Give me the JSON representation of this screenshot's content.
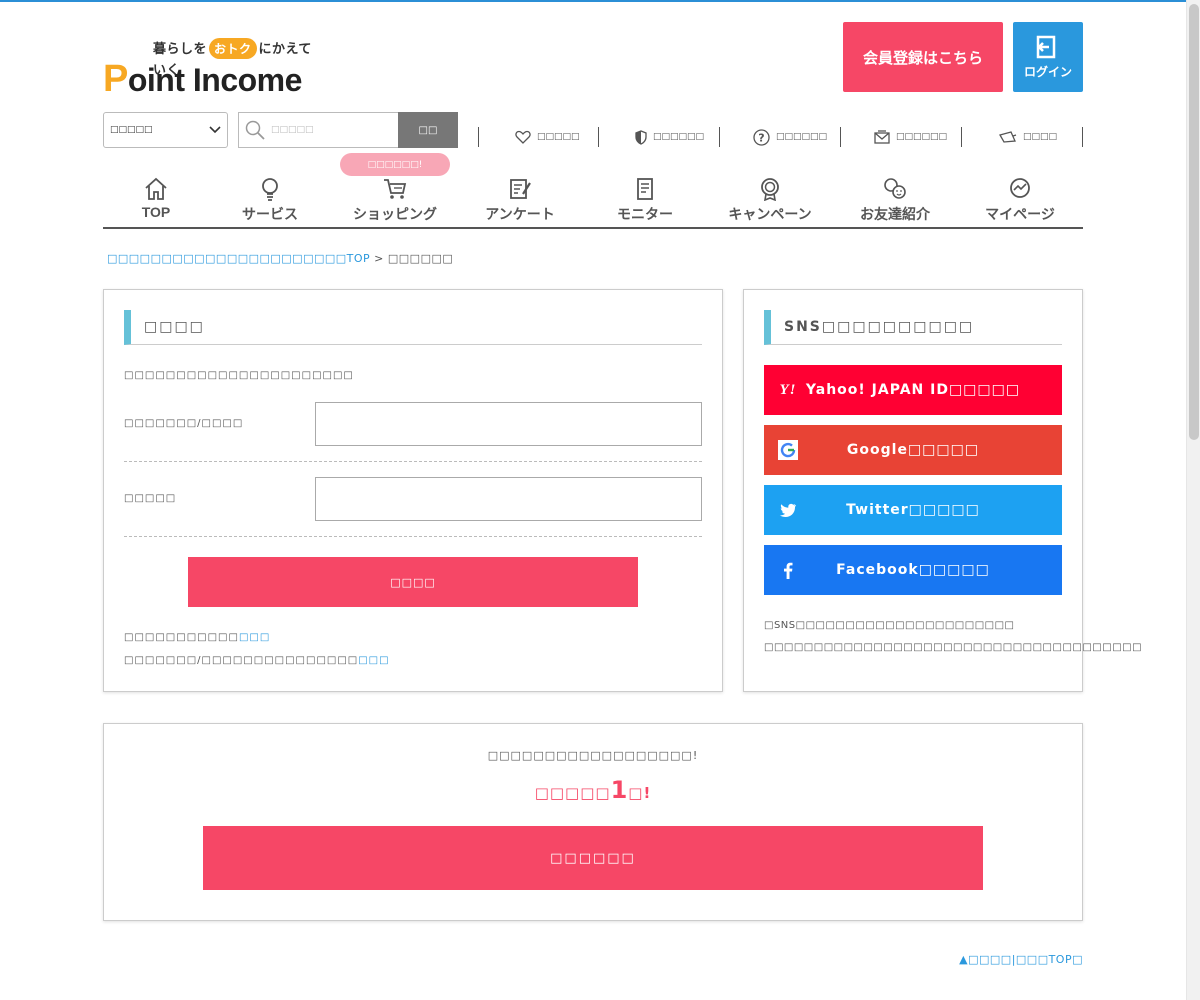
{
  "header": {
    "logo_tagline_pre": "暮らしを",
    "logo_tagline_badge": "おトク",
    "logo_tagline_post": "にかえていく",
    "logo_p": "P",
    "logo_rest": "oint Income",
    "register_button": "会員登録はこちら",
    "login_button": "ログイン"
  },
  "search": {
    "category_select": "□□□□□",
    "placeholder": "□□□□□",
    "button": "□□"
  },
  "utility_links": [
    {
      "label": "□□□□□",
      "icon": "heart-icon"
    },
    {
      "label": "□□□□□□",
      "icon": "shield-icon"
    },
    {
      "label": "□□□□□□",
      "icon": "help-icon"
    },
    {
      "label": "□□□□□□",
      "icon": "mail-icon"
    },
    {
      "label": "□□□□",
      "icon": "megaphone-icon"
    }
  ],
  "nav": {
    "shopping_badge": "□□□□□□!",
    "items": [
      {
        "label": "TOP",
        "icon": "home-icon"
      },
      {
        "label": "サービス",
        "icon": "lightbulb-icon"
      },
      {
        "label": "ショッピング",
        "icon": "cart-icon"
      },
      {
        "label": "アンケート",
        "icon": "survey-icon"
      },
      {
        "label": "モニター",
        "icon": "document-icon"
      },
      {
        "label": "キャンペーン",
        "icon": "medal-icon"
      },
      {
        "label": "お友達紹介",
        "icon": "friends-icon"
      },
      {
        "label": "マイページ",
        "icon": "mypage-icon"
      }
    ]
  },
  "breadcrumb": {
    "home_link": "□□□□□□□□□□□□□□□□□□□□□□TOP",
    "separator": ">",
    "current": "□□□□□□"
  },
  "login": {
    "title": "□□□□",
    "description": "□□□□□□□□□□□□□□□□□□□□□□",
    "email_label": "□□□□□□□/□□□□",
    "password_label": "□□□□□",
    "submit": "□□□□",
    "help1_text": "□□□□□□□□□□□",
    "help1_link": "□□□",
    "help2_text": "□□□□□□□/□□□□□□□□□□□□□□□",
    "help2_link": "□□□"
  },
  "sns": {
    "title": "SNS□□□□□□□□□□",
    "yahoo": "Yahoo! JAPAN ID□□□□□",
    "google": "Google□□□□□",
    "twitter": "Twitter□□□□□",
    "facebook": "Facebook□□□□□",
    "note1": "□SNS□□□□□□□□□□□□□□□□□□□□□□",
    "note2": "□□□□□□□□□□□□□□□□□□□□□□□□□□□□□□□□□□□□□□"
  },
  "register_cta": {
    "line1": "□□□□□□□□□□□□□□□□□□!",
    "line2_pre": "□□□□□",
    "line2_big": "1",
    "line2_post": "□!",
    "button": "□□□□□□"
  },
  "footer": {
    "links": "▲□□□□|□□□TOP□"
  },
  "colors": {
    "accent_pink": "#f64766",
    "login_blue": "#2a98dd",
    "title_bar": "#65c1d8",
    "yahoo": "#ff0033",
    "google": "#e84335",
    "twitter": "#1da1f2",
    "facebook": "#1877f2"
  }
}
